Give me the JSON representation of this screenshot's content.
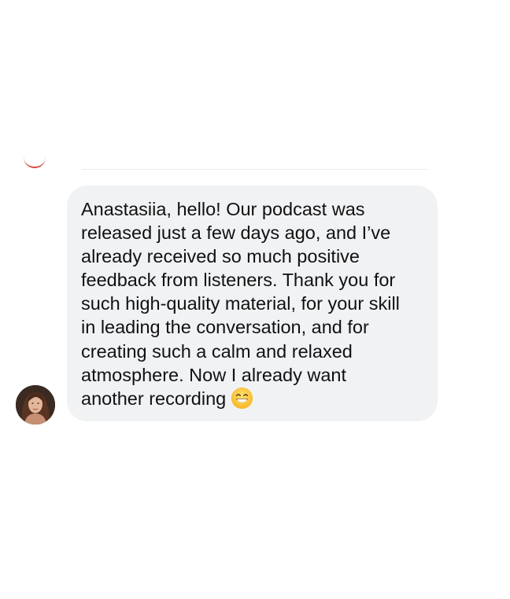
{
  "chat": {
    "message": {
      "text": "Anastasiia, hello! Our podcast was\nreleased just a few days ago, and I’ve\nalready received so much positive\nfeedback from listeners. Thank you for\nsuch high-quality material, for your skill\nin leading the conversation, and for\ncreating such a calm and relaxed\natmosphere. Now I already want\nanother recording",
      "emoji": "grinning-face-with-smiling-eyes",
      "bubble_color": "#f1f2f4"
    },
    "sender": {
      "avatar": "profile-photo"
    },
    "previous": {
      "avatar_ring_color": "#d6423a"
    }
  }
}
